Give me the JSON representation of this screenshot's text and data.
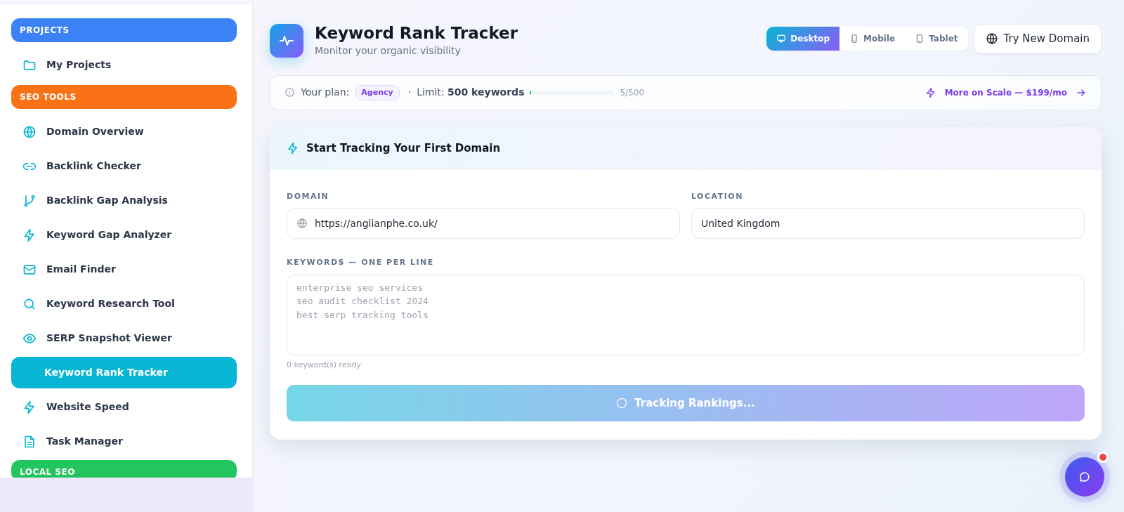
{
  "sidebar": {
    "items": [
      {
        "kind": "section",
        "label": "PROJECTS",
        "color": "#3b82f6"
      },
      {
        "kind": "link",
        "label": "My Projects",
        "selected": false
      },
      {
        "kind": "section",
        "label": "SEO TOOLS",
        "color": "#f97316"
      },
      {
        "kind": "link",
        "label": "Domain Overview",
        "selected": false
      },
      {
        "kind": "link",
        "label": "Backlink Checker",
        "selected": false
      },
      {
        "kind": "link",
        "label": "Backlink Gap Analysis",
        "selected": false
      },
      {
        "kind": "link",
        "label": "Keyword Gap Analyzer",
        "selected": false
      },
      {
        "kind": "link",
        "label": "Email Finder",
        "selected": false
      },
      {
        "kind": "link",
        "label": "Keyword Research Tool",
        "selected": false
      },
      {
        "kind": "link",
        "label": "SERP Snapshot Viewer",
        "selected": false
      },
      {
        "kind": "link",
        "label": "Keyword Rank Tracker",
        "selected": true
      },
      {
        "kind": "link",
        "label": "Website Speed",
        "selected": false
      },
      {
        "kind": "link",
        "label": "Task Manager",
        "selected": false
      },
      {
        "kind": "section",
        "label": "LOCAL SEO",
        "color": "#22c55e"
      }
    ]
  },
  "header": {
    "title": "Keyword Rank Tracker",
    "subtitle": "Monitor your organic visibility",
    "devices": [
      {
        "label": "Desktop",
        "selected": true
      },
      {
        "label": "Mobile",
        "selected": false
      },
      {
        "label": "Tablet",
        "selected": false
      }
    ],
    "action": "Try New Domain"
  },
  "plan": {
    "label": "Your plan:",
    "badge": "Agency",
    "separator": "·",
    "limit_label": "Limit:",
    "limit": "500 keywords",
    "level": 0.01,
    "count": "5/500",
    "upgrade": "More on Scale — $199/mo"
  },
  "card": {
    "title": "Start Tracking Your First Domain",
    "domain": {
      "label": "DOMAIN",
      "value": "https://anglianphe.co.uk/"
    },
    "location": {
      "label": "LOCATION",
      "value": "United Kingdom"
    },
    "keywords": {
      "label": "KEYWORDS — ONE PER LINE",
      "placeholder": "enterprise seo services\nseo audit checklist 2024\nbest serp tracking tools",
      "hint": "0 keyword(s) ready"
    },
    "submit": {
      "label": "Tracking Rankings...",
      "disabled": true
    }
  },
  "chat": {
    "notification": true
  }
}
